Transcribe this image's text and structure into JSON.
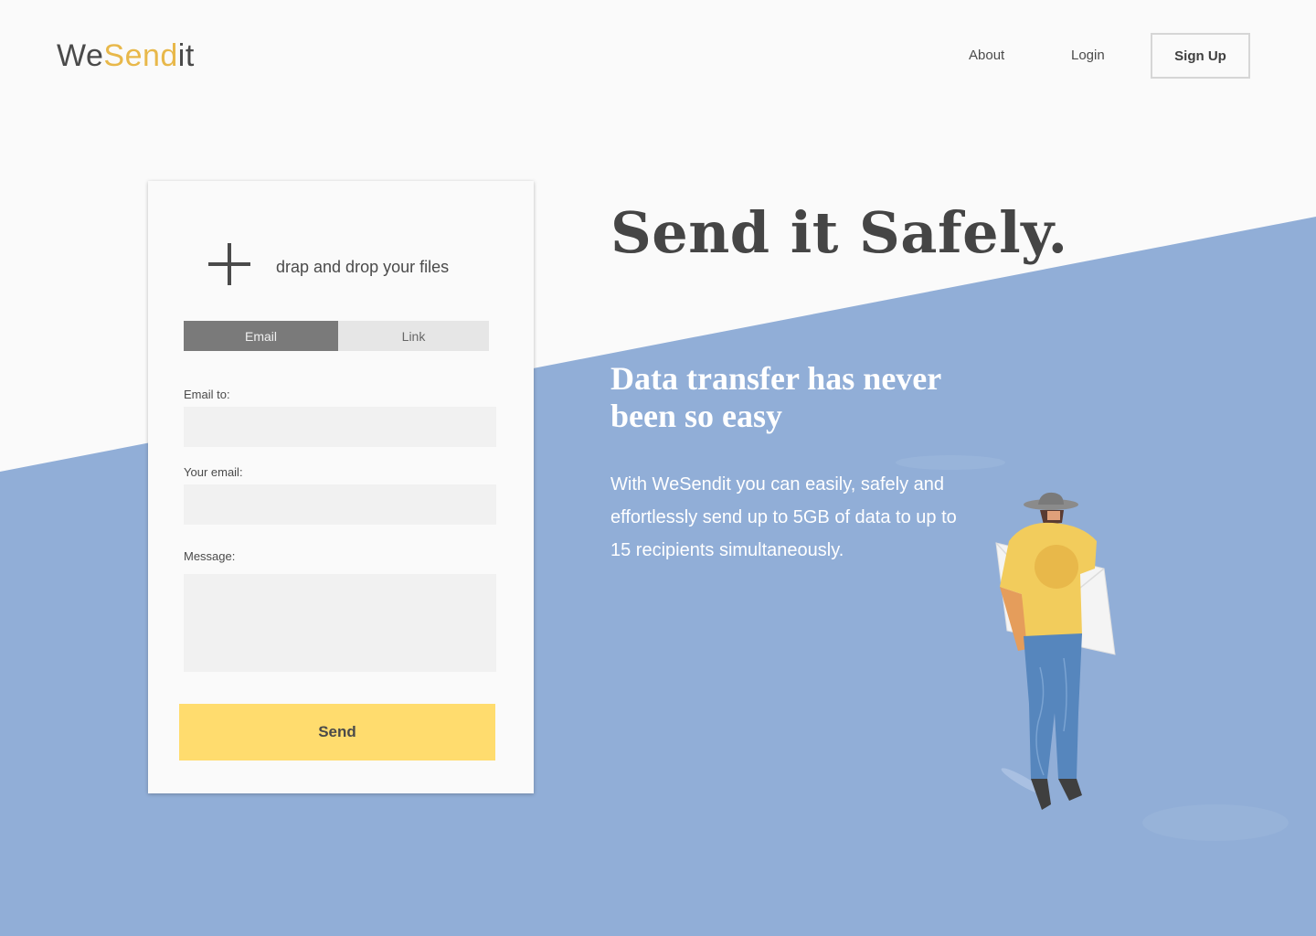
{
  "brand": {
    "part1": "We",
    "part2": "Send",
    "part3": "it"
  },
  "nav": {
    "about": "About",
    "login": "Login",
    "signup": "Sign Up"
  },
  "upload": {
    "drop_text": "drap and drop your files"
  },
  "tabs": {
    "email": "Email",
    "link": "Link",
    "active": "Email"
  },
  "form": {
    "email_to_label": "Email to:",
    "email_to_value": "",
    "your_email_label": "Your email:",
    "your_email_value": "",
    "message_label": "Message:",
    "message_value": "",
    "send_label": "Send"
  },
  "hero": {
    "title": "Send it Safely.",
    "subtitle": "Data transfer has never been so easy",
    "description": "With WeSendit you can easily, safely and effortlessly send up to 5GB of data to up to 15 recipients simultaneously."
  },
  "colors": {
    "background": "#fafafa",
    "accent_blue": "#91aed7",
    "accent_yellow": "#ffdc6e",
    "logo_yellow": "#e8b84a",
    "text_dark": "#4a4a4a"
  },
  "icons": {
    "upload": "plus-icon",
    "illustration": "person-with-envelope"
  }
}
